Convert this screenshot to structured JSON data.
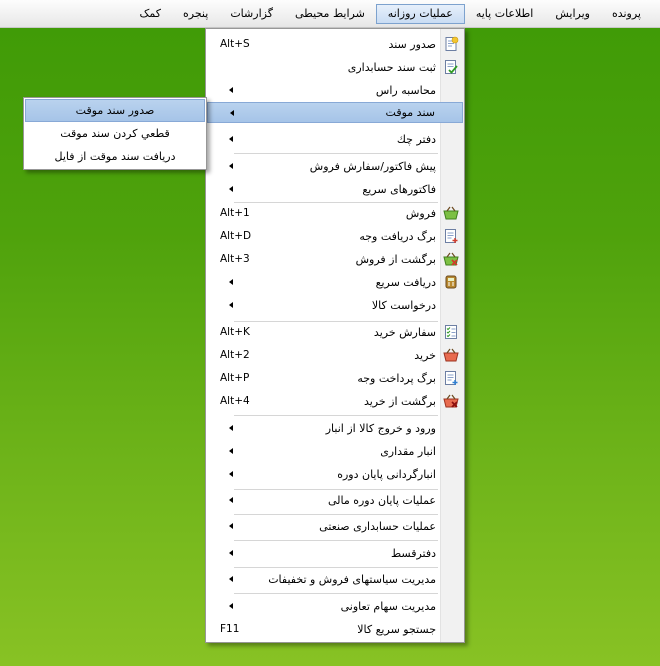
{
  "menubar": {
    "items": [
      {
        "label": "پرونده"
      },
      {
        "label": "ویرایش"
      },
      {
        "label": "اطلاعات پایه"
      },
      {
        "label": "عملیات روزانه"
      },
      {
        "label": "شرایط محیطی"
      },
      {
        "label": "گزارشات"
      },
      {
        "label": "پنجره"
      },
      {
        "label": "کمک"
      }
    ],
    "active_index": 3
  },
  "dropdown": {
    "items": [
      {
        "label": "صدور سند",
        "shortcut": "Alt+S",
        "icon": "document-new-icon"
      },
      {
        "label": "ثبت سند حسابداری",
        "shortcut": "",
        "icon": "document-check-icon"
      },
      {
        "label": "محاسبه راس",
        "shortcut": "",
        "submenu": true
      },
      {
        "label": "سند موقت",
        "shortcut": "",
        "submenu": true,
        "highlighted": true
      },
      {
        "label": "دفتر چك",
        "shortcut": "",
        "submenu": true
      },
      {
        "label": "پیش فاكتور/سفارش فروش",
        "shortcut": "",
        "submenu": true
      },
      {
        "label": "فاكتورهای سریع",
        "shortcut": "",
        "submenu": true
      },
      {
        "label": "فروش",
        "shortcut": "Alt+1",
        "icon": "basket-green-icon"
      },
      {
        "label": "برگ دریافت وجه",
        "shortcut": "Alt+D",
        "icon": "receipt-in-icon"
      },
      {
        "label": "برگشت از فروش",
        "shortcut": "Alt+3",
        "icon": "basket-green-return-icon"
      },
      {
        "label": "دریافت سریع",
        "shortcut": "",
        "icon": "cash-register-icon",
        "submenu": true
      },
      {
        "label": "درخواست كالا",
        "shortcut": "",
        "submenu": true
      },
      {
        "label": "سفارش خرید",
        "shortcut": "Alt+K",
        "icon": "checklist-icon"
      },
      {
        "label": "خرید",
        "shortcut": "Alt+2",
        "icon": "basket-red-icon"
      },
      {
        "label": "برگ پرداخت وجه",
        "shortcut": "Alt+P",
        "icon": "receipt-out-icon"
      },
      {
        "label": "برگشت از خرید",
        "shortcut": "Alt+4",
        "icon": "basket-red-return-icon"
      },
      {
        "label": "ورود و خروج كالا از انبار",
        "shortcut": "",
        "submenu": true
      },
      {
        "label": "انبار مقداری",
        "shortcut": "",
        "submenu": true
      },
      {
        "label": "انبارگردانی پایان دوره",
        "shortcut": "",
        "submenu": true
      },
      {
        "label": "عملیات پایان دوره مالی",
        "shortcut": "",
        "submenu": true
      },
      {
        "label": "عملیات حسابداری صنعتی",
        "shortcut": "",
        "submenu": true
      },
      {
        "label": "دفترقسط",
        "shortcut": "",
        "submenu": true
      },
      {
        "label": "مدیریت سیاستهای فروش و تخفیفات",
        "shortcut": "",
        "submenu": true
      },
      {
        "label": "مدیریت سهام تعاونی",
        "shortcut": "",
        "submenu": true
      },
      {
        "label": "جستجو سریع كالا",
        "shortcut": "F11"
      }
    ]
  },
  "submenu": {
    "items": [
      {
        "label": "صدور سند موقت",
        "highlighted": true
      },
      {
        "label": "قطعي كردن سند موقت"
      },
      {
        "label": "دریافت سند موقت از فایل"
      }
    ]
  },
  "colors": {
    "desktop_top": "#3e9a06",
    "desktop_bottom": "#88c224",
    "highlight": "#a6c4e8",
    "highlight_border": "#88a9d6"
  }
}
